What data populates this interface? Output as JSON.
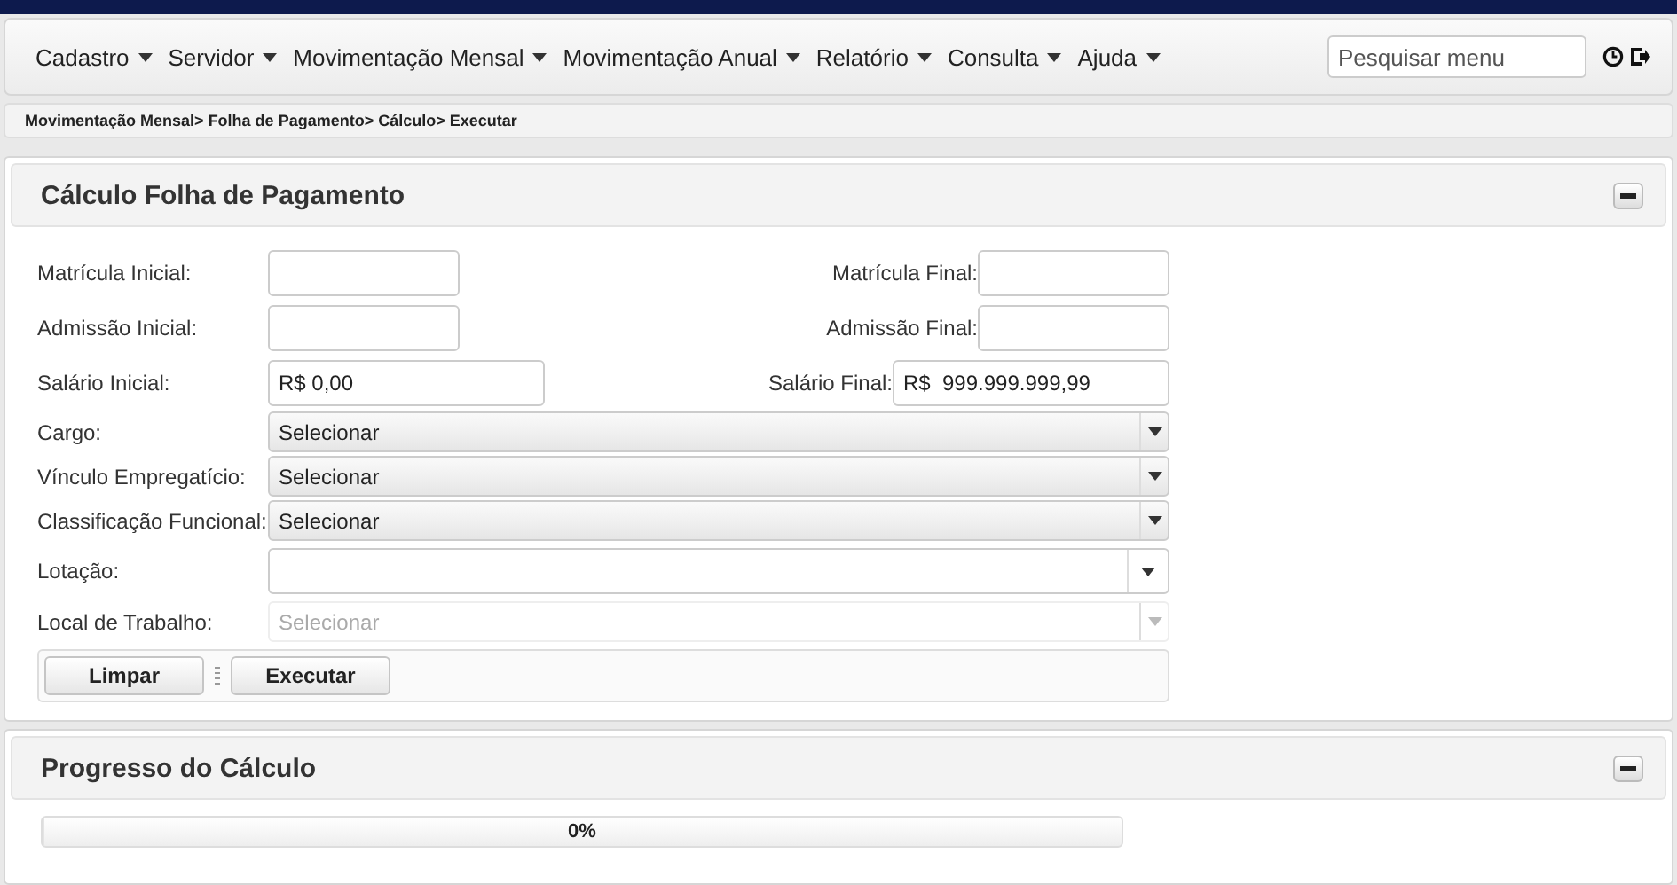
{
  "menu": [
    {
      "label": "Cadastro"
    },
    {
      "label": "Servidor"
    },
    {
      "label": "Movimentação Mensal"
    },
    {
      "label": "Movimentação Anual"
    },
    {
      "label": "Relatório"
    },
    {
      "label": "Consulta"
    },
    {
      "label": "Ajuda"
    }
  ],
  "search": {
    "placeholder": "Pesquisar menu"
  },
  "breadcrumb": [
    "Movimentação Mensal>",
    "Folha de Pagamento>",
    "Cálculo>",
    "Executar"
  ],
  "form_panel": {
    "title": "Cálculo Folha de Pagamento",
    "expanded": true,
    "pairs": [
      {
        "left_label": "Matrícula Inicial:",
        "right_label": "Matrícula Final:",
        "wide": false
      },
      {
        "left_label": "Admissão Inicial:",
        "right_label": "Admissão Final:",
        "wide": false
      },
      {
        "left_label": "Salário Inicial:",
        "left_value": "R$ 0,00",
        "right_label": "Salário Final:",
        "right_value": "R$  999.999.999,99",
        "wide": true
      }
    ],
    "selects": [
      {
        "kind": "select",
        "label": "Cargo:",
        "value": "Selecionar",
        "disabled": false
      },
      {
        "kind": "select",
        "label": "Vínculo Empregatício:",
        "value": "Selecionar",
        "disabled": false
      },
      {
        "kind": "select",
        "label": "Classificação Funcional:",
        "value": "Selecionar",
        "disabled": false
      },
      {
        "kind": "combo",
        "label": "Lotação:",
        "disabled": false
      },
      {
        "kind": "select",
        "label": "Local de Trabalho:",
        "value": "Selecionar",
        "disabled": true
      }
    ],
    "buttons": [
      "Limpar",
      "Executar"
    ]
  },
  "progress_panel": {
    "title": "Progresso do Cálculo",
    "expanded": true,
    "reading": "0%",
    "level": 0
  }
}
